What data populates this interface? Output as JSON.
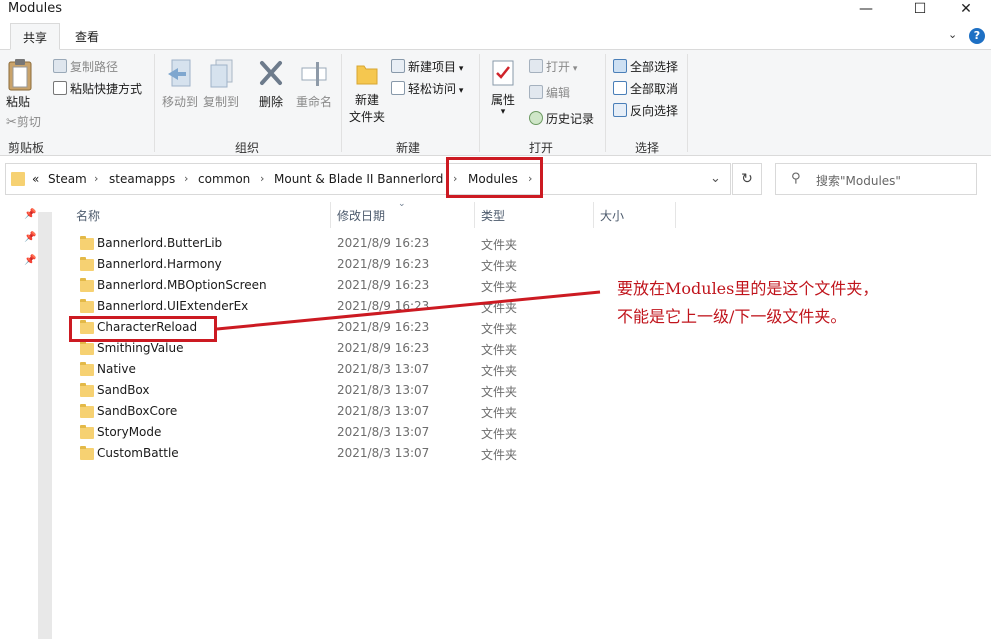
{
  "window": {
    "title": "Modules",
    "controls": {
      "minimize": "—",
      "maximize": "☐",
      "close": "✕"
    }
  },
  "ribbon_tabs": [
    "共享",
    "查看"
  ],
  "ribbon": {
    "clipboard": {
      "paste": "粘贴",
      "cut": "剪切",
      "copy_path": "复制路径",
      "paste_shortcut": "粘贴快捷方式",
      "label": "剪贴板"
    },
    "organize": {
      "move_to": "移动到",
      "copy_to": "复制到",
      "delete": "删除",
      "rename": "重命名",
      "label": "组织"
    },
    "new": {
      "new_folder_line1": "新建",
      "new_folder_line2": "文件夹",
      "new_item": "新建项目",
      "easy_access": "轻松访问",
      "label": "新建"
    },
    "open": {
      "properties": "属性",
      "open": "打开",
      "edit": "编辑",
      "history": "历史记录",
      "label": "打开"
    },
    "select": {
      "select_all": "全部选择",
      "select_none": "全部取消",
      "invert": "反向选择",
      "label": "选择"
    }
  },
  "address": {
    "overflow": "«",
    "crumbs": [
      "Steam",
      "steamapps",
      "common",
      "Mount & Blade II Bannerlord",
      "Modules"
    ]
  },
  "search": {
    "placeholder": "搜索\"Modules\""
  },
  "columns": {
    "name": "名称",
    "date": "修改日期",
    "type": "类型",
    "size": "大小"
  },
  "files": [
    {
      "name": "Bannerlord.ButterLib",
      "date": "2021/8/9 16:23",
      "type": "文件夹"
    },
    {
      "name": "Bannerlord.Harmony",
      "date": "2021/8/9 16:23",
      "type": "文件夹"
    },
    {
      "name": "Bannerlord.MBOptionScreen",
      "date": "2021/8/9 16:23",
      "type": "文件夹"
    },
    {
      "name": "Bannerlord.UIExtenderEx",
      "date": "2021/8/9 16:23",
      "type": "文件夹"
    },
    {
      "name": "CharacterReload",
      "date": "2021/8/9 16:23",
      "type": "文件夹"
    },
    {
      "name": "SmithingValue",
      "date": "2021/8/9 16:23",
      "type": "文件夹"
    },
    {
      "name": "Native",
      "date": "2021/8/3 13:07",
      "type": "文件夹"
    },
    {
      "name": "SandBox",
      "date": "2021/8/3 13:07",
      "type": "文件夹"
    },
    {
      "name": "SandBoxCore",
      "date": "2021/8/3 13:07",
      "type": "文件夹"
    },
    {
      "name": "StoryMode",
      "date": "2021/8/3 13:07",
      "type": "文件夹"
    },
    {
      "name": "CustomBattle",
      "date": "2021/8/3 13:07",
      "type": "文件夹"
    }
  ],
  "annotation": {
    "line1": "要放在Modules里的是这个文件夹，",
    "line2": "不能是它上一级/下一级文件夹。",
    "color": "#cc1a22"
  }
}
